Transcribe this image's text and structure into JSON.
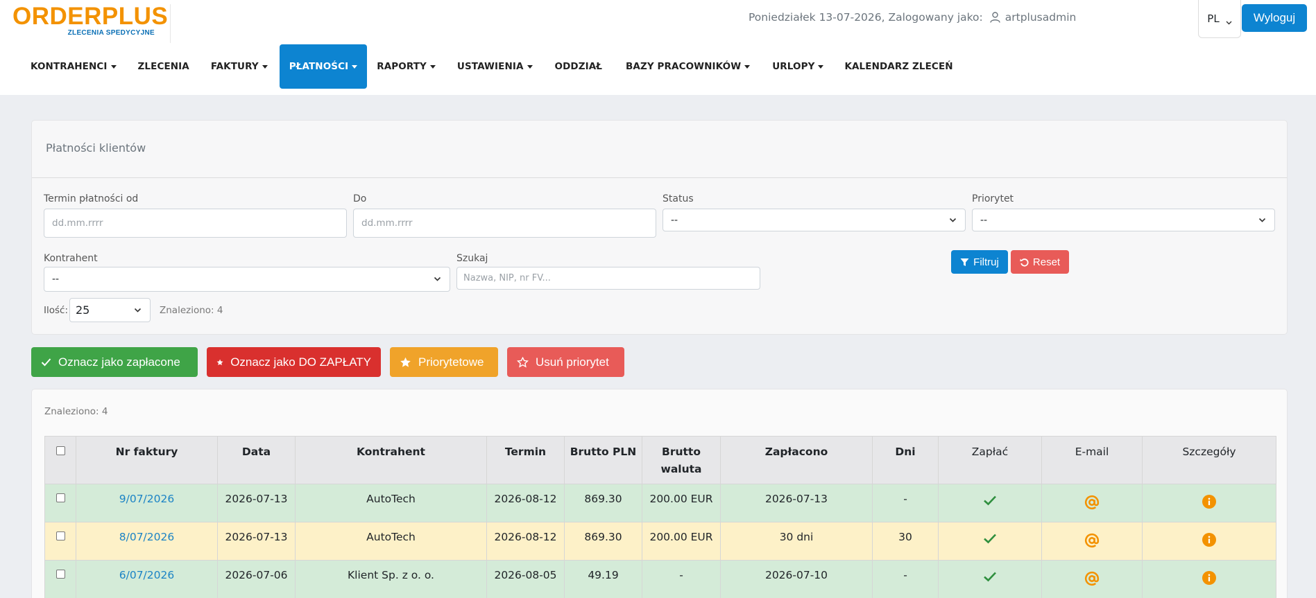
{
  "header": {
    "logo_main": "ORDERPLUS",
    "logo_sub": "ZLECENIA SPEDYCYJNE",
    "date_text": "Poniedziałek 13-07-2026, Zalogowany jako:",
    "username": "artplusadmin",
    "language": "PL",
    "logout_label": "Wyloguj"
  },
  "nav": {
    "items": [
      {
        "label": "KONTRAHENCI",
        "dropdown": true
      },
      {
        "label": "ZLECENIA",
        "dropdown": false
      },
      {
        "label": "FAKTURY",
        "dropdown": true
      },
      {
        "label": "PŁATNOŚCI",
        "dropdown": true,
        "active": true
      },
      {
        "label": "RAPORTY",
        "dropdown": true
      },
      {
        "label": "USTAWIENIA",
        "dropdown": true
      },
      {
        "label": "ODDZIAŁ",
        "dropdown": false
      },
      {
        "label": "BAZY PRACOWNIKÓW",
        "dropdown": true
      },
      {
        "label": "URLOPY",
        "dropdown": true
      },
      {
        "label": "KALENDARZ ZLECEŃ",
        "dropdown": false
      }
    ]
  },
  "filters": {
    "title": "Płatności klientów",
    "date_from_label": "Termin płatności od",
    "date_from_placeholder": "dd.mm.rrrr",
    "date_to_label": "Do",
    "date_to_placeholder": "dd.mm.rrrr",
    "status_label": "Status",
    "status_value": "--",
    "priority_label": "Priorytet",
    "priority_value": "--",
    "contractor_label": "Kontrahent",
    "contractor_value": "--",
    "search_label": "Szukaj",
    "search_placeholder": "Nazwa, NIP, nr FV...",
    "filter_label": "Filtruj",
    "reset_label": "Reset",
    "count_label": "Ilość:",
    "count_value": "25",
    "found_text": "Znaleziono: 4"
  },
  "actions": {
    "mark_paid": "Oznacz jako zapłacone",
    "mark_to_pay": "Oznacz jako DO ZAPŁATY",
    "priority": "Priorytetowe",
    "remove_priority": "Usuń priorytet"
  },
  "colors": {
    "primary": "#0d84d1",
    "success": "#3fa447",
    "danger": "#d9302e",
    "warning": "#f0a32a",
    "light_danger": "#e85b58",
    "logo_orange": "#f39200"
  },
  "table": {
    "found_text": "Znaleziono: 4",
    "headers": {
      "invoice": "Nr faktury",
      "date": "Data",
      "contractor": "Kontrahent",
      "due": "Termin",
      "gross_pln": "Brutto PLN",
      "gross_currency": "Brutto waluta",
      "paid": "Zapłacono",
      "days": "Dni",
      "pay": "Zapłać",
      "email": "E-mail",
      "details": "Szczegóły"
    },
    "rows": [
      {
        "invoice": "9/07/2026",
        "date": "2026-07-13",
        "contractor": "AutoTech",
        "due": "2026-08-12",
        "gross_pln": "869.30",
        "gross_currency": "200.00 EUR",
        "paid": "2026-07-13",
        "days": "-",
        "status": "green"
      },
      {
        "invoice": "8/07/2026",
        "date": "2026-07-13",
        "contractor": "AutoTech",
        "due": "2026-08-12",
        "gross_pln": "869.30",
        "gross_currency": "200.00 EUR",
        "paid": "30 dni",
        "days": "30",
        "status": "yellow"
      },
      {
        "invoice": "6/07/2026",
        "date": "2026-07-06",
        "contractor": "Klient Sp. z o. o.",
        "due": "2026-08-05",
        "gross_pln": "49.19",
        "gross_currency": "-",
        "paid": "2026-07-10",
        "days": "-",
        "status": "green"
      }
    ]
  }
}
